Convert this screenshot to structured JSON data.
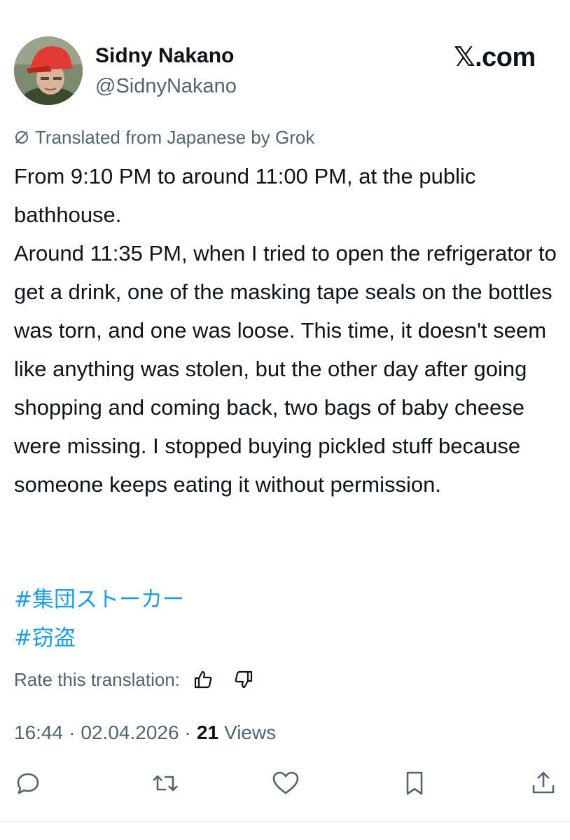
{
  "author": {
    "name": "Sidny Nakano",
    "handle": "@SidnyNakano"
  },
  "source": "𝕏.com",
  "translation": {
    "notice": "Translated from Japanese by Grok",
    "rate_label": "Rate this translation:"
  },
  "post": {
    "paragraphs": [
      "From 9:10 PM to around 11:00 PM, at the public bathhouse.",
      "Around 11:35 PM, when I tried to open the refrigerator to get a drink, one of the masking tape seals on the bottles was torn, and one was loose. This time, it doesn't seem like anything was stolen, but the other day after going shopping and coming back, two bags of baby cheese were missing. I stopped buying pickled stuff because someone keeps eating it without permission."
    ],
    "hashtags": [
      "#集団ストーカー",
      "#窃盗"
    ]
  },
  "meta": {
    "time": "16:44",
    "separator": "·",
    "date": "02.04.2026",
    "views_count": "21",
    "views_label": "Views"
  },
  "actions": {
    "icons": [
      "reply-icon",
      "repost-icon",
      "like-icon",
      "bookmark-icon",
      "share-icon"
    ]
  },
  "colors": {
    "text": "#0f1419",
    "secondary": "#536471",
    "link": "#1d9bf0"
  }
}
